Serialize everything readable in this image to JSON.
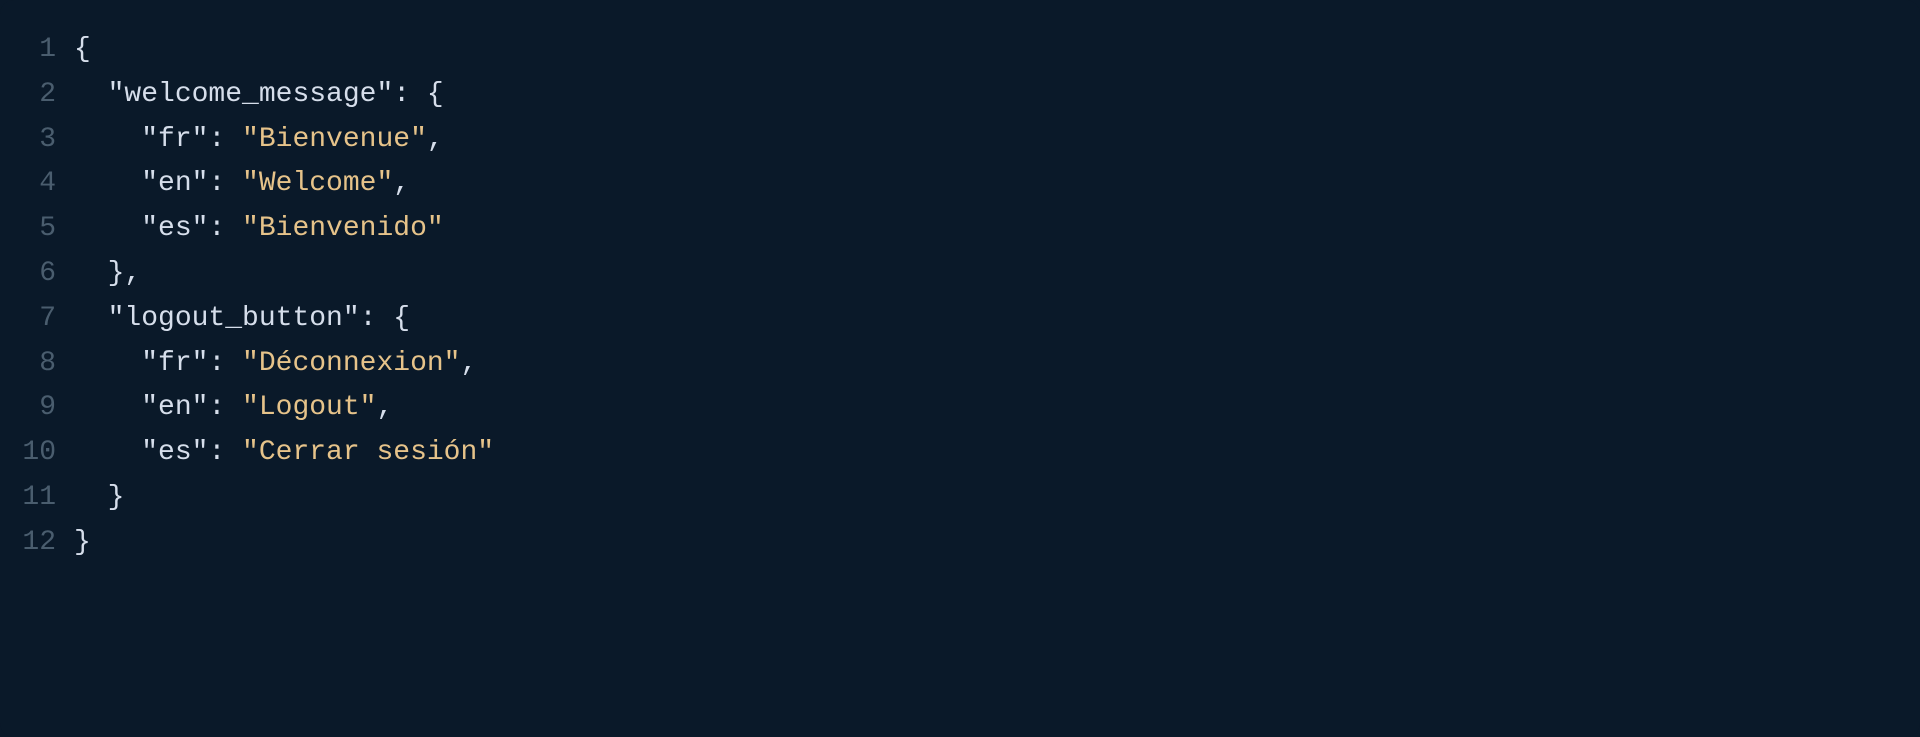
{
  "lines": [
    {
      "num": "1",
      "tokens": [
        {
          "t": "{",
          "c": "punct"
        }
      ]
    },
    {
      "num": "2",
      "tokens": [
        {
          "t": "  ",
          "c": "indent"
        },
        {
          "t": "\"welcome_message\"",
          "c": "key"
        },
        {
          "t": ": {",
          "c": "punct"
        }
      ]
    },
    {
      "num": "3",
      "tokens": [
        {
          "t": "    ",
          "c": "indent"
        },
        {
          "t": "\"fr\"",
          "c": "key"
        },
        {
          "t": ": ",
          "c": "punct"
        },
        {
          "t": "\"Bienvenue\"",
          "c": "string"
        },
        {
          "t": ",",
          "c": "punct"
        }
      ]
    },
    {
      "num": "4",
      "tokens": [
        {
          "t": "    ",
          "c": "indent"
        },
        {
          "t": "\"en\"",
          "c": "key"
        },
        {
          "t": ": ",
          "c": "punct"
        },
        {
          "t": "\"Welcome\"",
          "c": "string"
        },
        {
          "t": ",",
          "c": "punct"
        }
      ]
    },
    {
      "num": "5",
      "tokens": [
        {
          "t": "    ",
          "c": "indent"
        },
        {
          "t": "\"es\"",
          "c": "key"
        },
        {
          "t": ": ",
          "c": "punct"
        },
        {
          "t": "\"Bienvenido\"",
          "c": "string"
        }
      ]
    },
    {
      "num": "6",
      "tokens": [
        {
          "t": "  ",
          "c": "indent"
        },
        {
          "t": "},",
          "c": "punct"
        }
      ]
    },
    {
      "num": "7",
      "tokens": [
        {
          "t": "  ",
          "c": "indent"
        },
        {
          "t": "\"logout_button\"",
          "c": "key"
        },
        {
          "t": ": {",
          "c": "punct"
        }
      ]
    },
    {
      "num": "8",
      "tokens": [
        {
          "t": "    ",
          "c": "indent"
        },
        {
          "t": "\"fr\"",
          "c": "key"
        },
        {
          "t": ": ",
          "c": "punct"
        },
        {
          "t": "\"Déconnexion\"",
          "c": "string"
        },
        {
          "t": ",",
          "c": "punct"
        }
      ]
    },
    {
      "num": "9",
      "tokens": [
        {
          "t": "    ",
          "c": "indent"
        },
        {
          "t": "\"en\"",
          "c": "key"
        },
        {
          "t": ": ",
          "c": "punct"
        },
        {
          "t": "\"Logout\"",
          "c": "string"
        },
        {
          "t": ",",
          "c": "punct"
        }
      ]
    },
    {
      "num": "10",
      "tokens": [
        {
          "t": "    ",
          "c": "indent"
        },
        {
          "t": "\"es\"",
          "c": "key"
        },
        {
          "t": ": ",
          "c": "punct"
        },
        {
          "t": "\"Cerrar sesión\"",
          "c": "string"
        }
      ]
    },
    {
      "num": "11",
      "tokens": [
        {
          "t": "  ",
          "c": "indent"
        },
        {
          "t": "}",
          "c": "punct"
        }
      ]
    },
    {
      "num": "12",
      "tokens": [
        {
          "t": "}",
          "c": "punct"
        }
      ]
    }
  ]
}
